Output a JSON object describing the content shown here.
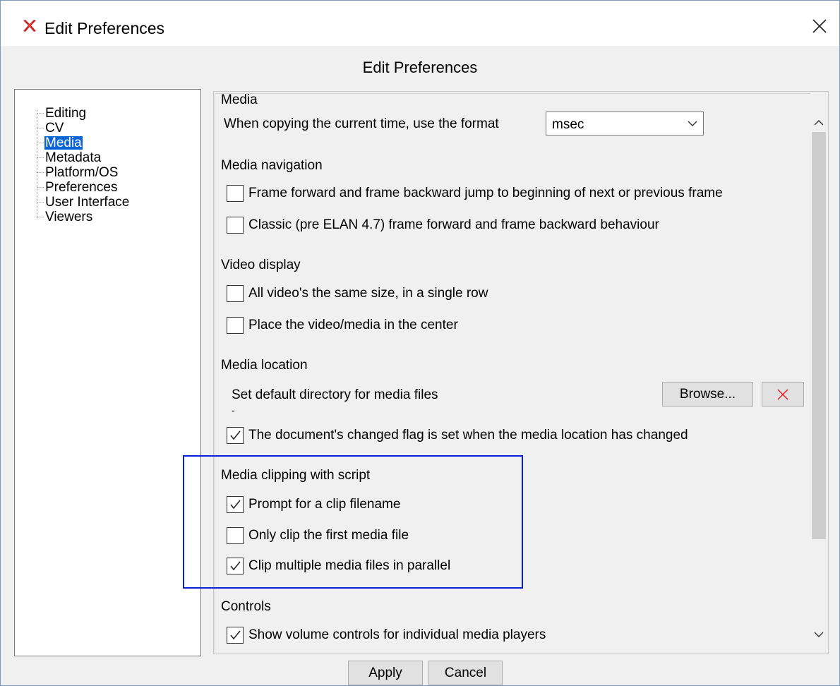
{
  "window": {
    "title": "Edit Preferences",
    "heading": "Edit Preferences"
  },
  "tree": {
    "items": [
      {
        "label": "Editing"
      },
      {
        "label": "CV"
      },
      {
        "label": "Media",
        "selected": true
      },
      {
        "label": "Metadata"
      },
      {
        "label": "Platform/OS"
      },
      {
        "label": "Preferences"
      },
      {
        "label": "User Interface"
      },
      {
        "label": "Viewers"
      }
    ]
  },
  "panel": {
    "section_title": "Media",
    "time_format": {
      "label": "When copying the current time, use the format",
      "value": "msec"
    },
    "navigation": {
      "heading": "Media navigation",
      "options": [
        {
          "label": "Frame forward and frame backward jump to beginning of next or previous frame",
          "checked": false
        },
        {
          "label": "Classic (pre ELAN 4.7) frame forward and frame backward behaviour",
          "checked": false
        }
      ]
    },
    "video_display": {
      "heading": "Video display",
      "options": [
        {
          "label": "All video's the same size, in a single row",
          "checked": false
        },
        {
          "label": "Place the video/media in the center",
          "checked": false
        }
      ]
    },
    "location": {
      "heading": "Media location",
      "default_dir_label": "Set default directory for media files",
      "default_dir_value": "-",
      "browse_label": "Browse...",
      "changed_flag": {
        "label": "The document's changed flag is set when the media location has changed",
        "checked": true
      }
    },
    "clipping": {
      "heading": "Media clipping with script",
      "options": [
        {
          "label": "Prompt for a clip filename",
          "checked": true
        },
        {
          "label": "Only clip the first media file",
          "checked": false
        },
        {
          "label": "Clip multiple media files in parallel",
          "checked": true
        }
      ]
    },
    "controls": {
      "heading": "Controls",
      "options": [
        {
          "label": "Show volume controls for individual media players",
          "checked": true
        }
      ]
    }
  },
  "buttons": {
    "apply": "Apply",
    "cancel": "Cancel"
  },
  "colors": {
    "selection": "#0a64d6",
    "highlight_box": "#0a1fd6",
    "clear_icon": "#e02020"
  }
}
